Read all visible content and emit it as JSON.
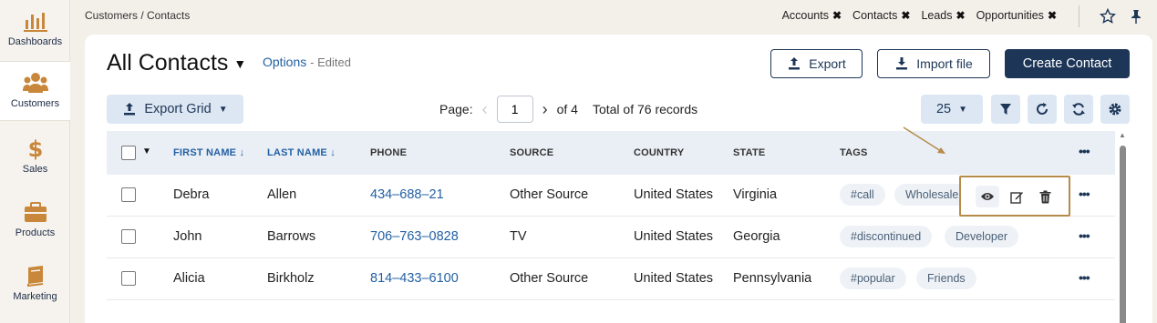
{
  "sidebar": {
    "items": [
      {
        "label": "Dashboards",
        "icon": "bar-chart-icon"
      },
      {
        "label": "Customers",
        "icon": "users-icon"
      },
      {
        "label": "Sales",
        "icon": "dollar-icon"
      },
      {
        "label": "Products",
        "icon": "briefcase-icon"
      },
      {
        "label": "Marketing",
        "icon": "book-icon"
      }
    ]
  },
  "topbar": {
    "breadcrumb": "Customers / Contacts",
    "chips": [
      "Accounts",
      "Contacts",
      "Leads",
      "Opportunities"
    ]
  },
  "header": {
    "title": "All Contacts",
    "options_label": "Options",
    "edited_label": "- Edited",
    "export_label": "Export",
    "import_label": "Import file",
    "create_label": "Create Contact"
  },
  "toolbar": {
    "export_grid_label": "Export Grid",
    "page_label": "Page:",
    "page_value": "1",
    "of_label": "of 4",
    "total_label": "Total of 76 records",
    "page_size": "25"
  },
  "table": {
    "columns": [
      "FIRST NAME",
      "LAST NAME",
      "PHONE",
      "SOURCE",
      "COUNTRY",
      "STATE",
      "TAGS"
    ],
    "rows": [
      {
        "first": "Debra",
        "last": "Allen",
        "phone": "434–688–21",
        "source": "Other Source",
        "country": "United States",
        "state": "Virginia",
        "tags": [
          "#call",
          "Wholesale"
        ]
      },
      {
        "first": "John",
        "last": "Barrows",
        "phone": "706–763–0828",
        "source": "TV",
        "country": "United States",
        "state": "Georgia",
        "tags": [
          "#discontinued",
          "Developer"
        ]
      },
      {
        "first": "Alicia",
        "last": "Birkholz",
        "phone": "814–433–6100",
        "source": "Other Source",
        "country": "United States",
        "state": "Pennsylvania",
        "tags": [
          "#popular",
          "Friends"
        ]
      }
    ]
  },
  "colors": {
    "accent": "#1d3658",
    "link": "#2360a4",
    "highlight": "#b68b4a"
  }
}
